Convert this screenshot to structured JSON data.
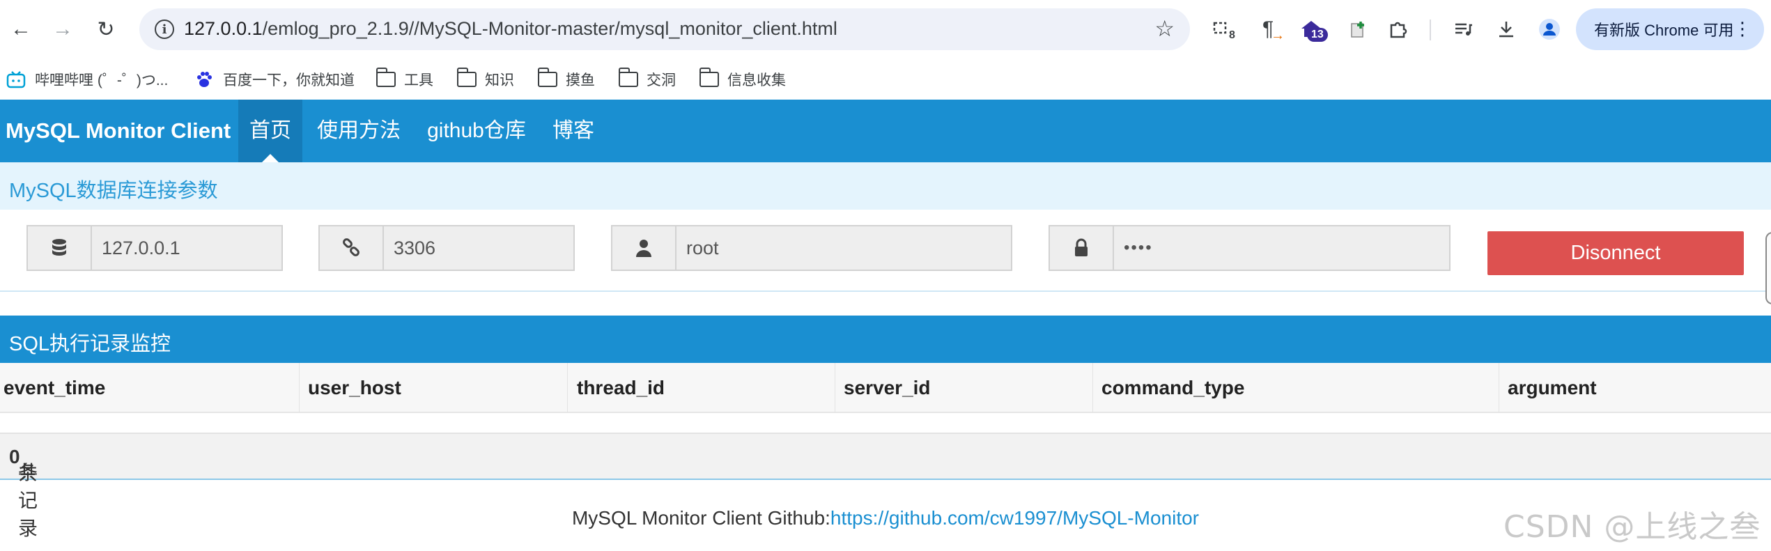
{
  "browser": {
    "url_host": "127.0.0.1",
    "url_path": "/emlog_pro_2.1.9//MySQL-Monitor-master/mysql_monitor_client.html",
    "ext_badge_1": "8",
    "ext_badge_2": "13",
    "update_label": "有新版 Chrome 可用",
    "icons": [
      "back-icon",
      "forward-icon",
      "reload-icon",
      "site-info-icon",
      "star-icon",
      "extensions-icon",
      "media-icon",
      "download-icon",
      "profile-icon",
      "menu-icon"
    ]
  },
  "bookmarks": [
    {
      "label": "哔哩哔哩 (゜-゜)つ..."
    },
    {
      "label": "百度一下，你就知道"
    },
    {
      "label": "工具"
    },
    {
      "label": "知识"
    },
    {
      "label": "摸鱼"
    },
    {
      "label": "交洞"
    },
    {
      "label": "信息收集"
    }
  ],
  "navbar": {
    "brand": "MySQL Monitor Client",
    "items": [
      {
        "label": "首页"
      },
      {
        "label": "使用方法"
      },
      {
        "label": "github仓库"
      },
      {
        "label": "博客"
      }
    ]
  },
  "connection": {
    "title": "MySQL数据库连接参数",
    "host": "127.0.0.1",
    "port": "3306",
    "user": "root",
    "password": "••••",
    "disconnect_label": "Disonnect"
  },
  "monitor": {
    "title": "SQL执行记录监控",
    "columns": [
      "event_time",
      "user_host",
      "thread_id",
      "server_id",
      "command_type",
      "argument"
    ],
    "footer_prefix": "共 ",
    "count": "0",
    "footer_suffix": " 条记录"
  },
  "footer": {
    "text": "MySQL Monitor Client Github:",
    "link": "https://github.com/cw1997/MySQL-Monitor"
  },
  "watermark": "CSDN @上线之叁",
  "colors": {
    "primary": "#1a8fd1",
    "primary_dark": "#157bb8",
    "danger": "#dd5150",
    "light_header": "#e4f4fd"
  }
}
